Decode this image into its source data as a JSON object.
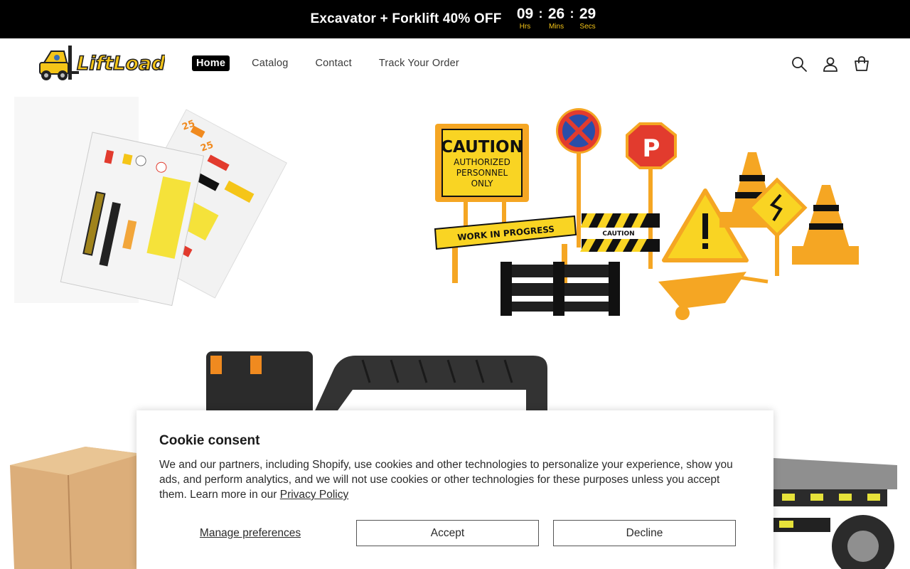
{
  "announcement": {
    "text": "Excavator + Forklift 40% OFF",
    "timer": [
      {
        "value": "09",
        "label": "Hrs"
      },
      {
        "value": "26",
        "label": "Mins"
      },
      {
        "value": "29",
        "label": "Secs"
      }
    ],
    "separator": ":",
    "accent_color": "#f5c518"
  },
  "header": {
    "logo_text": "LiftLoads",
    "nav": [
      {
        "label": "Home",
        "active": true
      },
      {
        "label": "Catalog",
        "active": false
      },
      {
        "label": "Contact",
        "active": false
      },
      {
        "label": "Track Your Order",
        "active": false
      }
    ],
    "icons": [
      "search-icon",
      "account-icon",
      "cart-icon"
    ]
  },
  "hero": {
    "signs": {
      "caution_title": "CAUTION",
      "caution_line1": "AUTHORIZED",
      "caution_line2": "PERSONNEL",
      "caution_line3": "ONLY",
      "parking": "P",
      "barrier": "WORK IN PROGRESS",
      "barrier_small": "CAUTION"
    },
    "sticker_numbers": [
      "25",
      "25"
    ]
  },
  "cookie": {
    "title": "Cookie consent",
    "text": "We and our partners, including Shopify, use cookies and other technologies to personalize your experience, show you ads, and perform analytics, and we will not use cookies or other technologies for these purposes unless you accept them. Learn more in our ",
    "link": "Privacy Policy",
    "manage": "Manage preferences",
    "accept": "Accept",
    "decline": "Decline"
  }
}
